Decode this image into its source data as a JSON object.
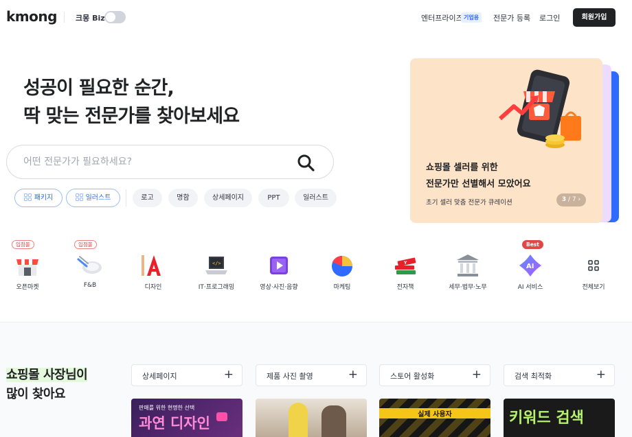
{
  "header": {
    "logo": "kmong",
    "biz_label": "크몽 Biz",
    "nav": {
      "enterprise": "엔터프라이즈",
      "enterprise_badge": "기업용",
      "pro_register": "전문가 등록",
      "login": "로그인",
      "signup": "회원가입"
    }
  },
  "hero": {
    "title_line1": "성공이 필요한 순간,",
    "title_line2": "딱 맞는 전문가를 찾아보세요",
    "search_placeholder": "어떤 전문가가 필요하세요?",
    "chips": [
      "패키지",
      "일러스트",
      "로고",
      "명함",
      "상세페이지",
      "PPT",
      "일러스트"
    ]
  },
  "promo": {
    "title_line1": "쇼핑몰 셀러를 위한",
    "title_line2": "전문가만 선별해서 모았어요",
    "subtitle": "초기 셀러 맞춤 전문가 큐레이션",
    "pager_current": "3",
    "pager_total": "/ 7",
    "pager_arrow": "›"
  },
  "categories": [
    {
      "label": "오픈마켓",
      "badge": "입점몰",
      "icon": "store-icon"
    },
    {
      "label": "F&B",
      "badge": "입점몰",
      "icon": "dish-icon"
    },
    {
      "label": "디자인",
      "badge": "",
      "icon": "design-icon"
    },
    {
      "label": "IT·프로그래밍",
      "badge": "",
      "icon": "laptop-icon"
    },
    {
      "label": "영상·사진·음향",
      "badge": "",
      "icon": "video-icon"
    },
    {
      "label": "마케팅",
      "badge": "",
      "icon": "pie-chart-icon"
    },
    {
      "label": "전자책",
      "badge": "",
      "icon": "books-icon"
    },
    {
      "label": "세무·법무·노무",
      "badge": "",
      "icon": "building-icon"
    },
    {
      "label": "AI 서비스",
      "badge": "Best",
      "icon": "ai-icon"
    },
    {
      "label": "전체보기",
      "badge": "",
      "icon": "grid-icon"
    }
  ],
  "section": {
    "title_line1": "쇼핑몰 사장님이",
    "title_line2": "많이 찾아요",
    "tags": [
      "상세페이지",
      "제품 사진 촬영",
      "스토어 활성화",
      "검색 최적화"
    ],
    "plus": "+",
    "thumbs": [
      {
        "top_text": "판매를 위한 현명한 선택",
        "big_text": "과연 디자인"
      },
      {
        "top_text": "",
        "big_text": ""
      },
      {
        "top_text": "실제 사용자",
        "big_text": ""
      },
      {
        "top_text": "",
        "big_text": "키워드 검색"
      }
    ]
  },
  "colors": {
    "brand_dark": "#212224",
    "accent_blue": "#2f6bff",
    "promo_bg": "#fde3c7",
    "badge_red": "#e04848",
    "highlight_green": "#e4f8dc"
  }
}
